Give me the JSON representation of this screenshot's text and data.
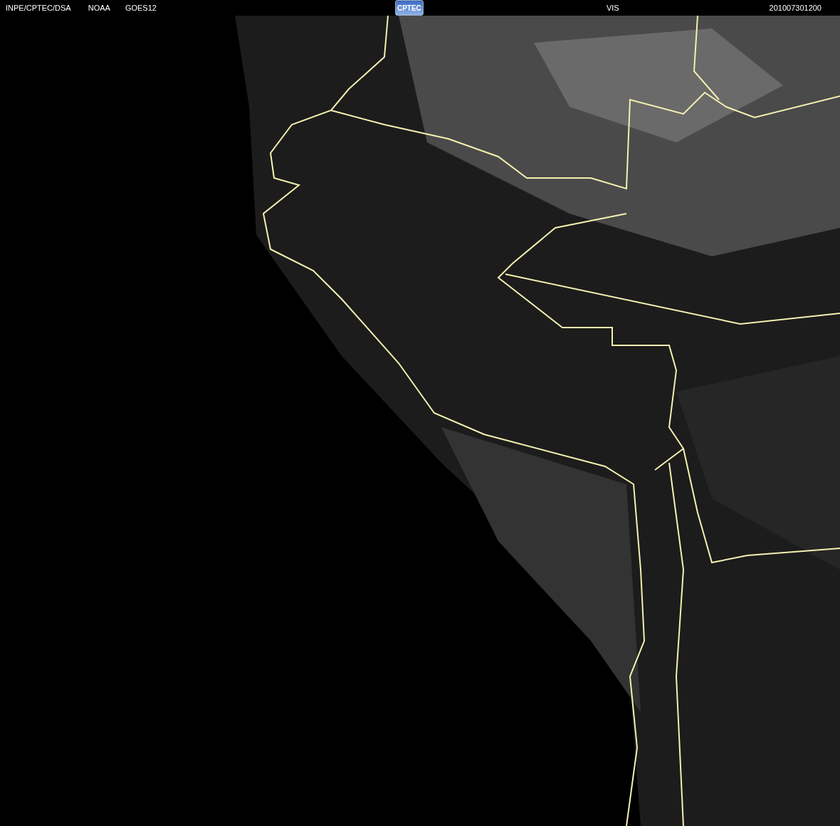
{
  "header": {
    "source": "INPE/CPTEC/DSA",
    "agency": "NOAA",
    "satellite": "GOES12",
    "logo": "CPTEC",
    "channel": "VIS",
    "timestamp": "201007301200"
  }
}
